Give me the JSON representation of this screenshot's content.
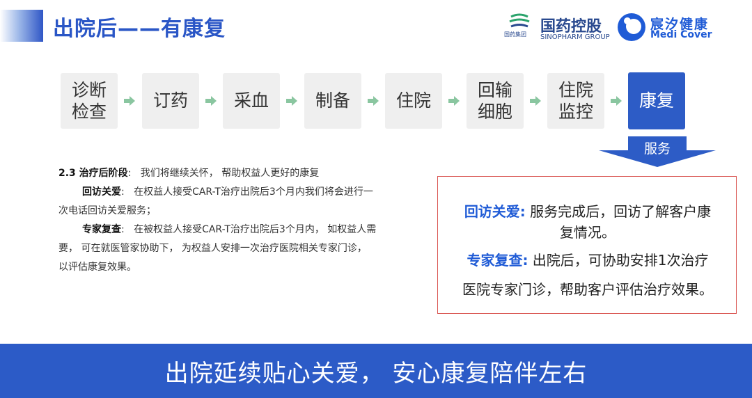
{
  "header": {
    "title": "出院后——有康复",
    "logos": {
      "sinopharm_cn": "国药控股",
      "sinopharm_en": "SINOPHARM GROUP",
      "sinopharm_small": "国药集团",
      "medicover_cn": "宸汐健康",
      "medicover_en": "Medi Cover"
    }
  },
  "flow": {
    "steps": [
      "诊断检查",
      "订药",
      "采血",
      "制备",
      "住院",
      "回输细胞",
      "住院监控",
      "康复"
    ],
    "active_step": "康复",
    "service_label": "服务",
    "colors": {
      "active": "#2d5cc6",
      "inactive": "#efefef",
      "arrow": "#8ac6a0"
    }
  },
  "left_text": {
    "stage_label": "2.3 治疗后阶段",
    "stage_desc": "我们将继续关怀， 帮助权益人更好的康复",
    "item1_label": "回访关爱",
    "item1_desc_a": "在权益人接受CAR-T治疗出院后3个月内我们将会进行一",
    "item1_desc_b": "次电话回访关爱服务；",
    "item2_label": "专家复查",
    "item2_desc_a": "在被权益人接受CAR-T治疗出院后3个月内， 如权益人需",
    "item2_desc_b": "要， 可在就医管家协助下， 为权益人安排一次治疗医院相关专家门诊，",
    "item2_desc_c": "以评估康复效果。"
  },
  "red_box": {
    "line1_key": "回访关爱:",
    "line1_text": " 服务完成后，回访了解客户康",
    "line2_text": "复情况。",
    "line3_key": "专家复查:",
    "line3_text": " 出院后，可协助安排1次治疗",
    "line4_text": "医院专家门诊，帮助客户评估治疗效果。",
    "colors": {
      "border": "#d9534f",
      "key": "#1f5bd6"
    }
  },
  "footer": {
    "slogan": "出院延续贴心关爱， 安心康复陪伴左右",
    "color": "#2c5bc7"
  }
}
